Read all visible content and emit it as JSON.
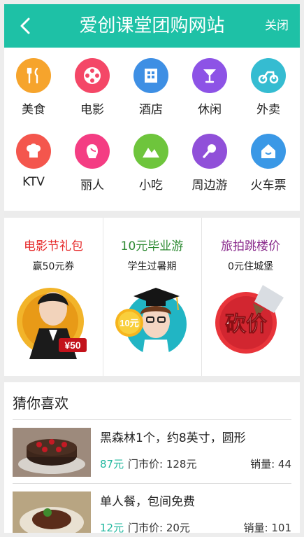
{
  "header": {
    "title": "爱创课堂团购网站",
    "close_label": "关闭"
  },
  "colors": {
    "accent": "#1ec1a6"
  },
  "categories": [
    {
      "label": "美食",
      "icon": "fork-knife-icon",
      "color": "#f6a42c"
    },
    {
      "label": "电影",
      "icon": "film-reel-icon",
      "color": "#f44767"
    },
    {
      "label": "酒店",
      "icon": "hotel-icon",
      "color": "#3e8fe4"
    },
    {
      "label": "休闲",
      "icon": "cocktail-icon",
      "color": "#8d53e6"
    },
    {
      "label": "外卖",
      "icon": "scooter-icon",
      "color": "#35bcd1"
    },
    {
      "label": "KTV",
      "icon": "chef-hat-icon",
      "color": "#f4564d"
    },
    {
      "label": "丽人",
      "icon": "beauty-icon",
      "color": "#f43d83"
    },
    {
      "label": "小吃",
      "icon": "mountain-icon",
      "color": "#6ec53c"
    },
    {
      "label": "周边游",
      "icon": "microphone-icon",
      "color": "#9050d9"
    },
    {
      "label": "火车票",
      "icon": "home-icon",
      "color": "#3a98e6"
    }
  ],
  "promos": [
    {
      "title": "电影节礼包",
      "subtitle": "赢50元券",
      "title_color": "#e62a2a",
      "badge": "¥50"
    },
    {
      "title": "10元毕业游",
      "subtitle": "学生过暑期",
      "title_color": "#2d8a32",
      "badge": "10元"
    },
    {
      "title": "旅拍跳楼价",
      "subtitle": "0元住城堡",
      "title_color": "#8a2b8c",
      "badge": "砍价"
    }
  ],
  "guess": {
    "heading": "猜你喜欢",
    "items": [
      {
        "name": "黑森林1个，约8英寸，圆形",
        "price": "87元",
        "market": "门市价: 128元",
        "sales": "销量: 44"
      },
      {
        "name": "单人餐，包间免费",
        "price": "12元",
        "market": "门市价: 20元",
        "sales": "销量: 101"
      }
    ]
  }
}
